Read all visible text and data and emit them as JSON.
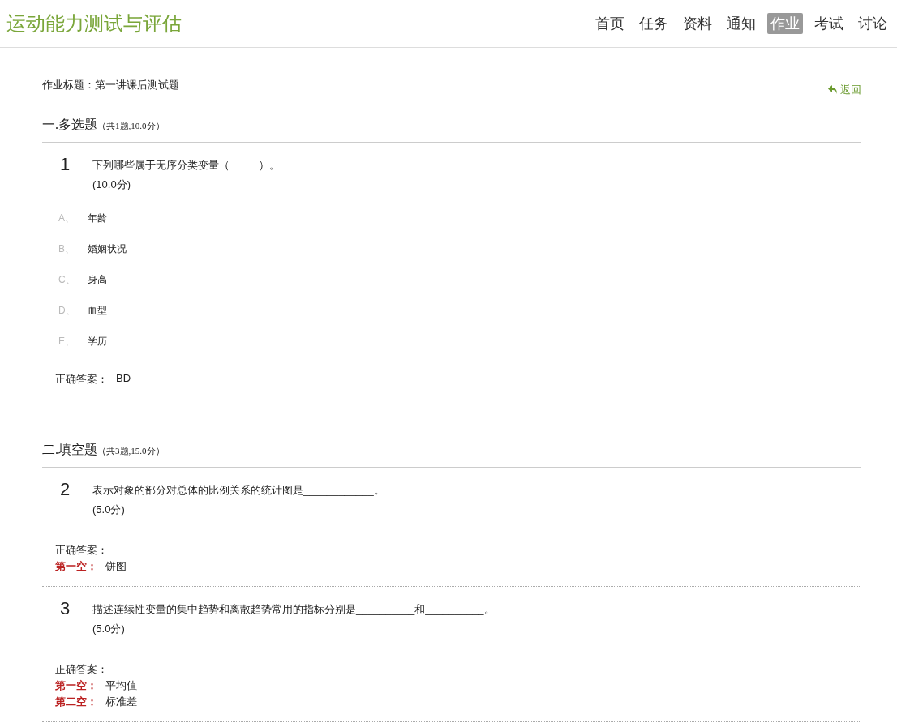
{
  "site_title": "运动能力测试与评估",
  "nav": [
    {
      "label": "首页",
      "selected": false
    },
    {
      "label": "任务",
      "selected": false
    },
    {
      "label": "资料",
      "selected": false
    },
    {
      "label": "通知",
      "selected": false
    },
    {
      "label": "作业",
      "selected": true
    },
    {
      "label": "考试",
      "selected": false
    },
    {
      "label": "讨论",
      "selected": false
    }
  ],
  "assignment_title": "作业标题：第一讲课后测试题",
  "back_link": "返回",
  "sections": [
    {
      "title": "一.多选题",
      "summary": "（共1题,10.0分）",
      "questions": [
        {
          "kind": "choice",
          "number": "1",
          "text": "下列哪些属于无序分类变量（          ）。",
          "score": "(10.0分)",
          "options": [
            {
              "letter": "A、",
              "text": "年龄"
            },
            {
              "letter": "B、",
              "text": "婚姻状况"
            },
            {
              "letter": "C、",
              "text": "身高"
            },
            {
              "letter": "D、",
              "text": "血型"
            },
            {
              "letter": "E、",
              "text": "学历"
            }
          ],
          "answer_label": "正确答案：",
          "answer": "BD"
        }
      ]
    },
    {
      "title": "二.填空题",
      "summary": "（共3题,15.0分）",
      "questions": [
        {
          "kind": "blank",
          "number": "2",
          "text": "表示对象的部分对总体的比例关系的统计图是____________。",
          "score": "(5.0分)",
          "answer_label": "正确答案：",
          "blanks": [
            {
              "label": "第一空：",
              "value": "饼图"
            }
          ]
        },
        {
          "kind": "blank",
          "number": "3",
          "text": "描述连续性变量的集中趋势和离散趋势常用的指标分别是__________和__________。",
          "score": "(5.0分)",
          "answer_label": "正确答案：",
          "blanks": [
            {
              "label": "第一空：",
              "value": "平均值"
            },
            {
              "label": "第二空：",
              "value": "标准差"
            }
          ]
        }
      ]
    }
  ]
}
